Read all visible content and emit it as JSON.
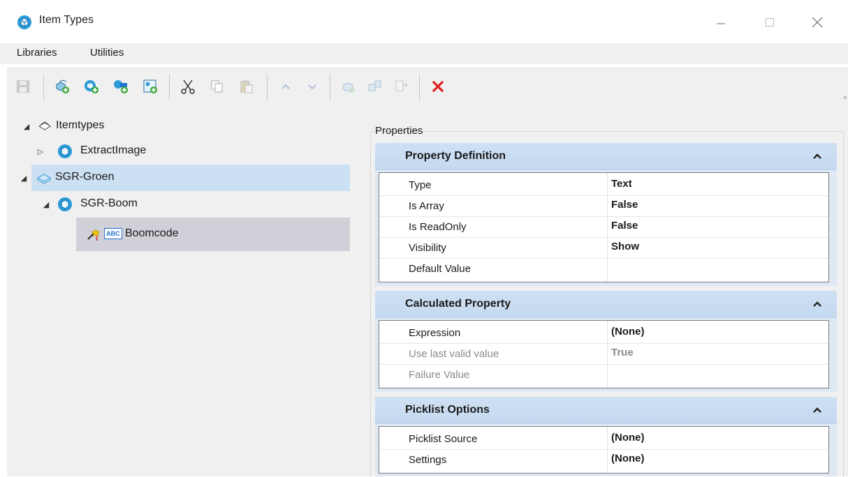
{
  "window": {
    "title": "Item Types"
  },
  "menu": {
    "libraries": "Libraries",
    "utilities": "Utilities"
  },
  "toolbar": {
    "icons": [
      "save-icon",
      "add-library-icon",
      "add-item-type-icon",
      "add-property-icon",
      "import-icon",
      "cut-icon",
      "copy-icon",
      "paste-icon",
      "move-up-icon",
      "move-down-icon",
      "attach-icon",
      "detach-icon",
      "edit-icon",
      "delete-icon"
    ],
    "delete_color": "#e02020"
  },
  "tree": {
    "root": "Itemtypes",
    "extract_image": "ExtractImage",
    "library": "SGR-Groen",
    "item_type": "SGR-Boom",
    "property": "Boomcode",
    "property_type_badge": "ABC",
    "selection_color": "#cce0f4"
  },
  "properties": {
    "label": "Properties",
    "sections": {
      "definition": {
        "title": "Property Definition",
        "rows": [
          {
            "name": "Type",
            "value": "Text"
          },
          {
            "name": "Is Array",
            "value": "False"
          },
          {
            "name": "Is ReadOnly",
            "value": "False"
          },
          {
            "name": "Visibility",
            "value": "Show"
          },
          {
            "name": "Default Value",
            "value": ""
          }
        ]
      },
      "calculated": {
        "title": "Calculated Property",
        "rows": [
          {
            "name": "Expression",
            "value": "(None)"
          },
          {
            "name": "Use last valid value",
            "value": "True"
          },
          {
            "name": "Failure Value",
            "value": ""
          }
        ]
      },
      "picklist": {
        "title": "Picklist Options",
        "rows": [
          {
            "name": "Picklist Source",
            "value": "(None)"
          },
          {
            "name": "Settings",
            "value": "(None)"
          }
        ]
      }
    },
    "header_color": "#c9dcf1"
  }
}
